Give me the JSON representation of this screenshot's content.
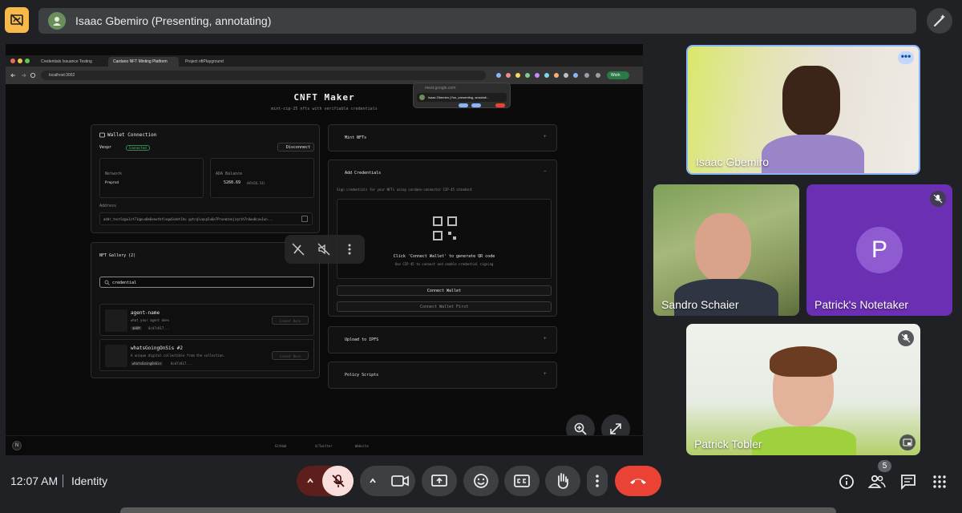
{
  "topbar": {
    "presenter_label": "Isaac Gbemiro (Presenting, annotating)"
  },
  "shared_screen": {
    "tabs": [
      "Credentials Issuance Testing",
      "Cardano NFT Minting Platform",
      "Project nftPlayground"
    ],
    "url": "localhost:3002",
    "work_badge": "Work",
    "meet_popup": {
      "site": "meet.google.com",
      "label": "Isaac Gbemiro (You, presenting, annotati..."
    },
    "app": {
      "title": "CNFT Maker",
      "subtitle": "mint-cip-25 nfts with verifiable credentials",
      "wallet": {
        "heading": "Wallet Connection",
        "wallet_name": "Vespr",
        "status": "Connected",
        "disconnect": "Disconnect",
        "network_label": "Network",
        "network_value": "Preprod",
        "balance_label": "ADA Balance",
        "balance_value": "5260.69",
        "balance_sub": "(₳5426.54)",
        "address_label": "Address",
        "address_value": "addr_test1qpu1st71qpvu6m6eeutktlequ6sdet1hu yptcqlvqsp5u6e7Prunmznnjcqrzh7n4wu0cuu1un..."
      },
      "gallery": {
        "heading": "NFT Gallery (2)",
        "search_value": "credential",
        "items": [
          {
            "name": "agent-name",
            "desc": "what your agent does",
            "tag": "$HUM",
            "id": "0cd7c817...",
            "action": "Cannot Burn"
          },
          {
            "name": "whatsGoingOnSis #2",
            "desc": "A unique digital collectible from the collection.",
            "tag": "whatsGoingOnSis",
            "id": "0cd7c817...",
            "action": "Cannot Burn"
          }
        ]
      },
      "mint": {
        "heading": "Mint NFTs"
      },
      "credentials": {
        "heading": "Add Credentials",
        "intro": "Sign credentials for your NFTs using cardano-connector CIP-45 standard",
        "qr_title": "Click 'Connect Wallet' to generate QR code",
        "qr_sub": "Use CIP-45 to connect and enable credential signing",
        "connect_btn": "Connect Wallet",
        "connect_first": "Connect Wallet First"
      },
      "ipfs": {
        "heading": "Upload to IPFS"
      },
      "policy": {
        "heading": "Policy Scripts"
      },
      "footer": {
        "github": "GitHub",
        "twitter": "X/Twitter",
        "website": "Website"
      }
    }
  },
  "participants": [
    {
      "name": "Isaac Gbemiro"
    },
    {
      "name": "Sandro Schaier"
    },
    {
      "name": "Patrick's Notetaker",
      "initial": "P"
    },
    {
      "name": "Patrick Tobler"
    }
  ],
  "bottombar": {
    "time": "12:07 AM",
    "meeting_name": "Identity",
    "people_count": "5"
  },
  "colors": {
    "accent_yellow": "#f6b94a",
    "end_call_red": "#ea4335",
    "mic_muted_bg": "#f9dedc",
    "notetaker_purple": "#6b2fb3"
  }
}
